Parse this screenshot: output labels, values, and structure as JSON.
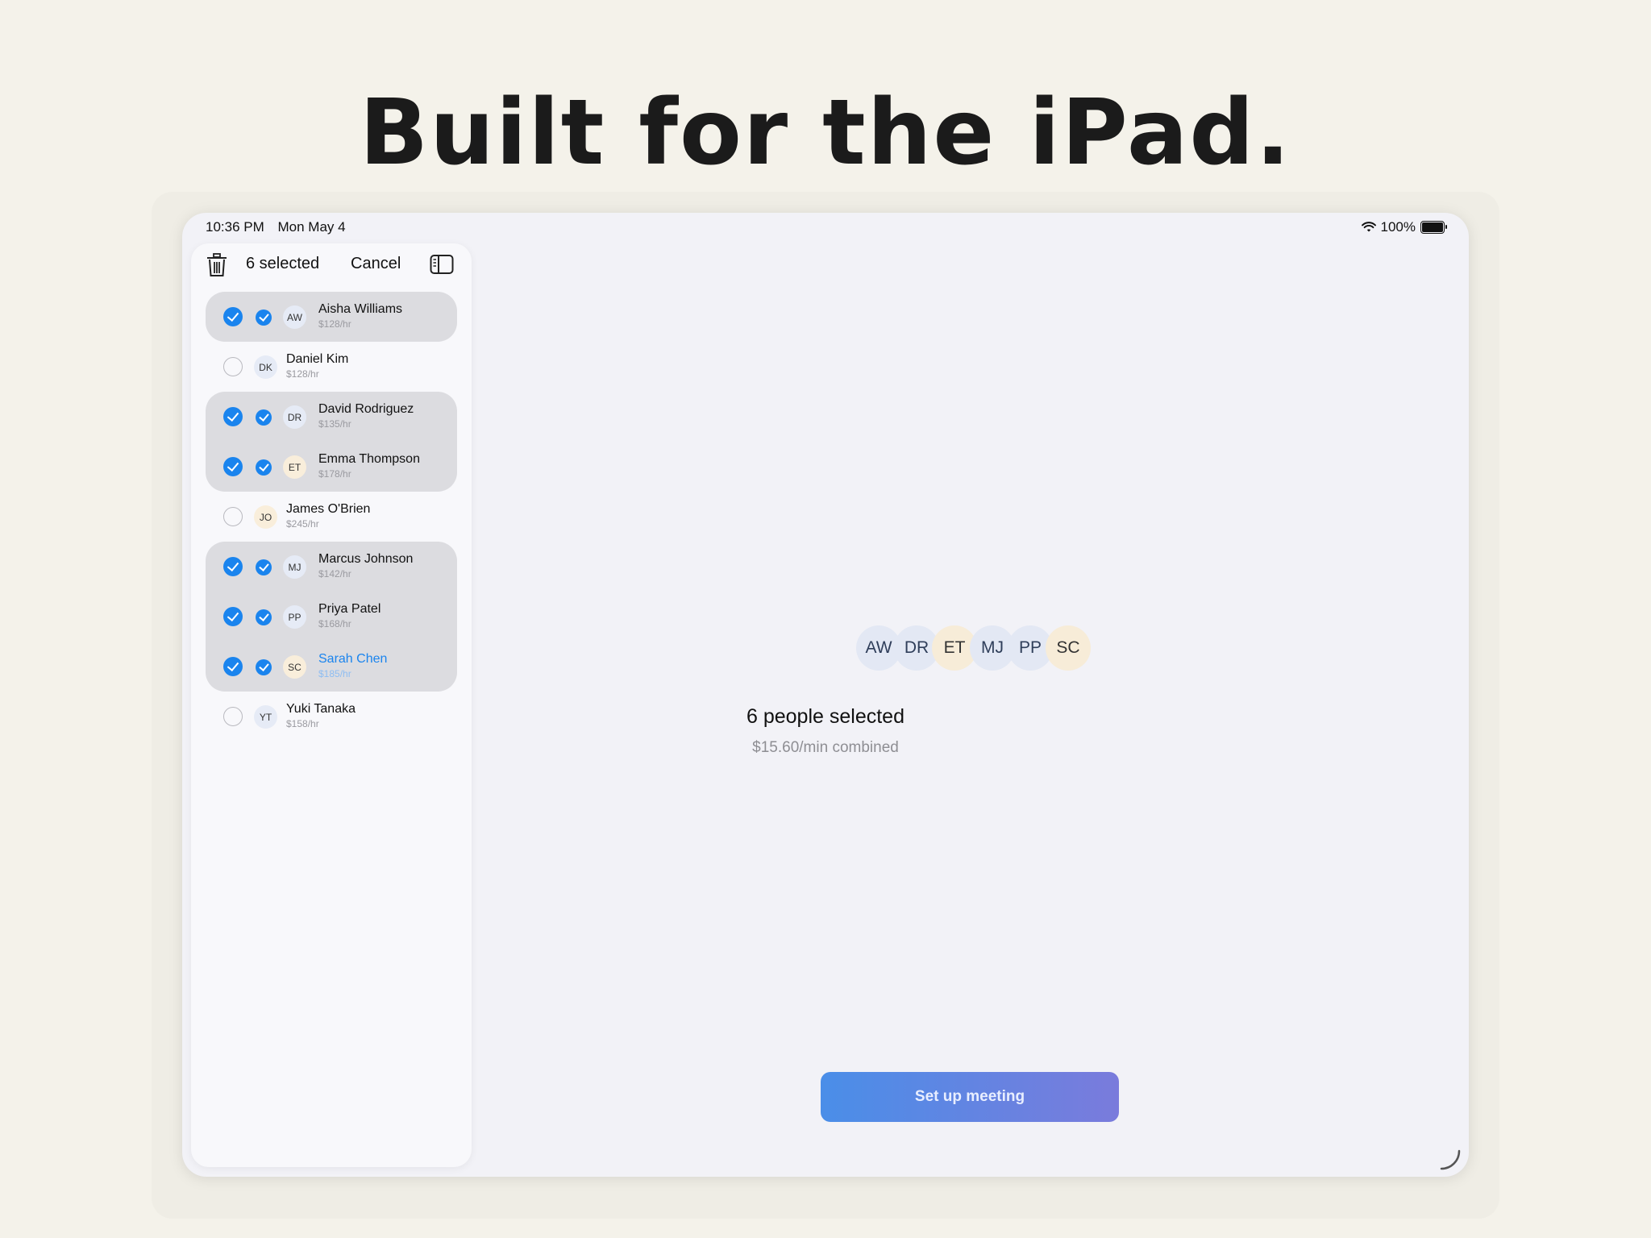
{
  "headline": "Built for the iPad.",
  "status_bar": {
    "time": "10:36 PM",
    "date": "Mon May 4",
    "battery": "100%",
    "battery_level": 1.0
  },
  "sidebar": {
    "selected_count_label": "6 selected",
    "cancel_label": "Cancel",
    "people": [
      {
        "initials": "AW",
        "name": "Aisha Williams",
        "rate": "$128/hr",
        "selected": true
      },
      {
        "initials": "DK",
        "name": "Daniel Kim",
        "rate": "$128/hr",
        "selected": false
      },
      {
        "initials": "DR",
        "name": "David Rodriguez",
        "rate": "$135/hr",
        "selected": true
      },
      {
        "initials": "ET",
        "name": "Emma Thompson",
        "rate": "$178/hr",
        "selected": true
      },
      {
        "initials": "JO",
        "name": "James O'Brien",
        "rate": "$245/hr",
        "selected": false
      },
      {
        "initials": "MJ",
        "name": "Marcus Johnson",
        "rate": "$142/hr",
        "selected": true
      },
      {
        "initials": "PP",
        "name": "Priya Patel",
        "rate": "$168/hr",
        "selected": true
      },
      {
        "initials": "SC",
        "name": "Sarah Chen",
        "rate": "$185/hr",
        "selected": true,
        "active": true
      },
      {
        "initials": "YT",
        "name": "Yuki Tanaka",
        "rate": "$158/hr",
        "selected": false
      }
    ]
  },
  "detail": {
    "avatar_stack": [
      "AW",
      "DR",
      "ET",
      "MJ",
      "PP",
      "SC"
    ],
    "title": "6 people selected",
    "subtitle": "$15.60/min combined",
    "cta_label": "Set up meeting"
  },
  "colors": {
    "accent": "#1a84ee",
    "background": "#f4f2ea",
    "cta_start": "#4a8ee8",
    "cta_end": "#7a7bdc"
  }
}
